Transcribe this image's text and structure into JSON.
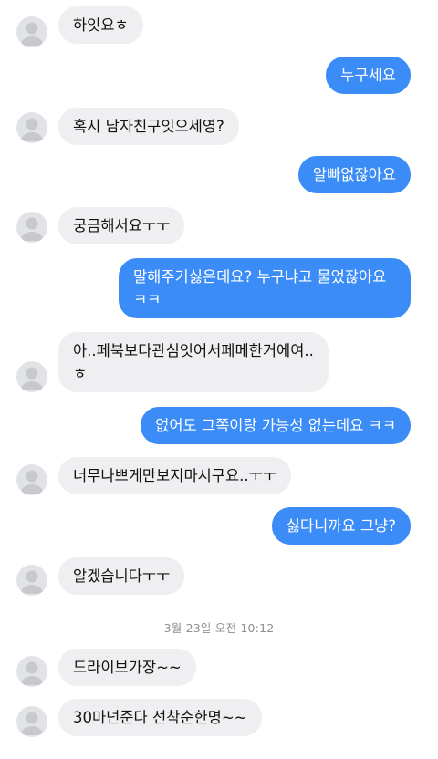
{
  "colors": {
    "incoming_bubble": "#efeff1",
    "outgoing_bubble": "#3b8cf6",
    "incoming_text": "#121212",
    "outgoing_text": "#ffffff",
    "avatar_placeholder": "#e1e3e6",
    "timestamp_text": "#8e8e93"
  },
  "messages": [
    {
      "sender": "other",
      "text": "하잇요ㅎ"
    },
    {
      "sender": "me",
      "text": "누구세요"
    },
    {
      "sender": "other",
      "text": "혹시 남자친구잇으세영?"
    },
    {
      "sender": "me",
      "text": "알빠없잖아요"
    },
    {
      "sender": "other",
      "text": "궁금해서요ㅜㅜ"
    },
    {
      "sender": "me",
      "text": "말해주기싫은데요? 누구냐고 물었잖아요 ㅋㅋ"
    },
    {
      "sender": "other",
      "text": "아..페북보다관심잇어서페메한거에여..ㅎ"
    },
    {
      "sender": "me",
      "text": "없어도 그쪽이랑 가능성 없는데요 ㅋㅋ"
    },
    {
      "sender": "other",
      "text": "너무나쁘게만보지마시구요..ㅜㅜ"
    },
    {
      "sender": "me",
      "text": "싫다니까요 그냥?"
    },
    {
      "sender": "other",
      "text": "알겠습니다ㅜㅜ"
    },
    {
      "sender": "other",
      "text": "드라이브가장~~"
    },
    {
      "sender": "other",
      "text": "30마넌준다 선착순한명~~"
    }
  ],
  "timestamp": "3월 23일 오전 10:12",
  "avatar_icon": "default-profile-icon"
}
